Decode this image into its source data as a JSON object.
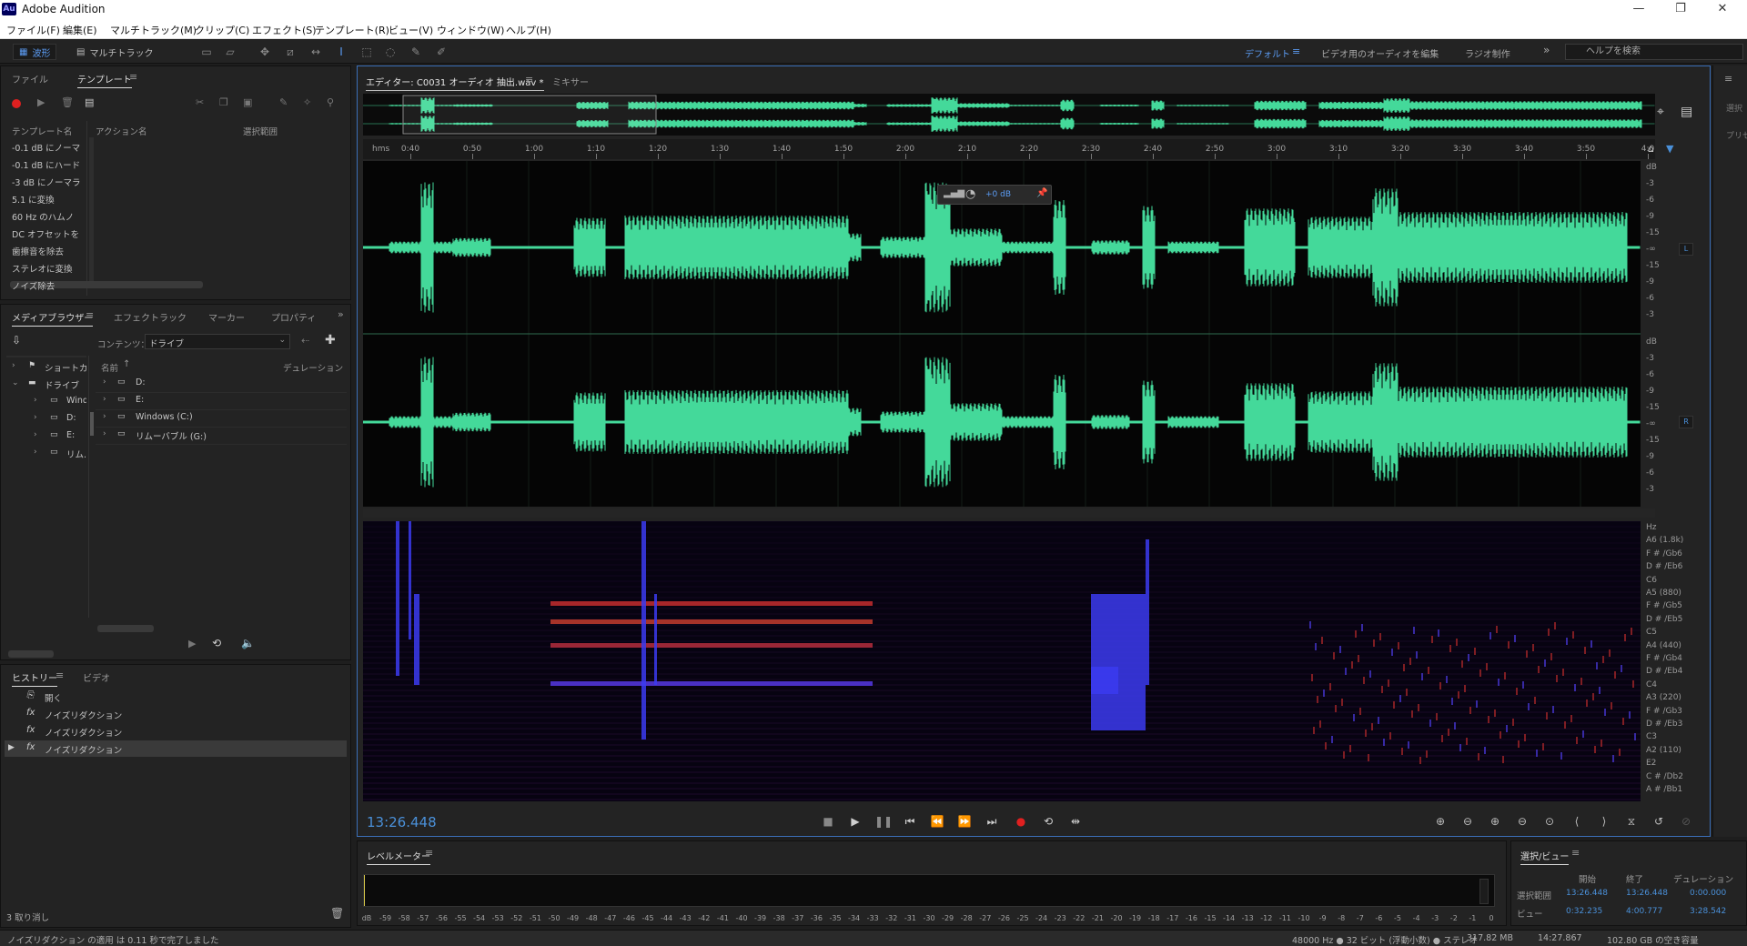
{
  "window": {
    "app_icon": "Au",
    "title": "Adobe Audition",
    "controls": {
      "minimize": "—",
      "maximize": "❐",
      "close": "✕"
    }
  },
  "menu": [
    "ファイル(F)",
    "編集(E)",
    "マルチトラック(M)",
    "クリップ(C)",
    "エフェクト(S)",
    "テンプレート(R)",
    "ビュー(V)",
    "ウィンドウ(W)",
    "ヘルプ(H)"
  ],
  "toolbar": {
    "waveform_label": "波形",
    "multitrack_label": "マルチトラック",
    "workspaces": [
      "デフォルト",
      "ビデオ用のオーディオを編集",
      "ラジオ制作"
    ],
    "active_workspace": "デフォルト",
    "more": "»",
    "search_placeholder": "ヘルプを検索"
  },
  "templates_panel": {
    "tabs": [
      "ファイル",
      "テンプレート"
    ],
    "active_tab": "テンプレート",
    "columns": [
      "テンプレート名",
      "アクション名",
      "選択範囲"
    ],
    "rows": [
      "-0.1 dB にノーマ",
      "-0.1 dB にハード",
      "-3 dB にノーマラ",
      "5.1 に変換",
      "60 Hz のハムノ",
      "DC オフセットを",
      "歯擦音を除去",
      "ステレオに変換",
      "ノイズ除去"
    ]
  },
  "media_panel": {
    "tabs": [
      "メディアブラウザー",
      "エフェクトラック",
      "マーカー",
      "プロパティ"
    ],
    "active_tab": "メディアブラウザー",
    "contents_label": "コンテンツ：",
    "contents_value": "ドライブ",
    "tree": [
      "ショートカ",
      "ドライブ",
      "Wind",
      "D:",
      "E:",
      "リム..."
    ],
    "columns": [
      "名前",
      "デュレーション"
    ],
    "items": [
      "D:",
      "E:",
      "Windows (C:)",
      "リムーバブル (G:)"
    ]
  },
  "history_panel": {
    "tabs": [
      "ヒストリー",
      "ビデオ"
    ],
    "active_tab": "ヒストリー",
    "items": [
      "開く",
      "ノイズリダクション",
      "ノイズリダクション",
      "ノイズリダクション"
    ],
    "selected_index": 3,
    "undo_count": "3 取り消し"
  },
  "editor": {
    "tabs": [
      "エディター: C0031 オーディオ 抽出.wav *",
      "ミキサー"
    ],
    "hud_gain": "+0 dB",
    "ruler_unit": "hms",
    "ruler_labels": [
      "0:40",
      "0:50",
      "1:00",
      "1:10",
      "1:20",
      "1:30",
      "1:40",
      "1:50",
      "2:00",
      "2:10",
      "2:20",
      "2:30",
      "2:40",
      "2:50",
      "3:00",
      "3:10",
      "3:20",
      "3:30",
      "3:40",
      "3:50",
      "4:0"
    ],
    "db_axis_top": [
      "dB",
      "-3",
      "-6",
      "-9",
      "-15",
      "-∞",
      "-15",
      "-9",
      "-6",
      "-3"
    ],
    "db_axis_bottom": [
      "dB",
      "-3",
      "-6",
      "-9",
      "-15",
      "-∞",
      "-15",
      "-9",
      "-6",
      "-3"
    ],
    "channel_left": "L",
    "channel_right": "R",
    "hz_axis": [
      "Hz",
      "A6 (1.8k)",
      "F # /Gb6",
      "D # /Eb6",
      "C6",
      "A5 (880)",
      "F # /Gb5",
      "D # /Eb5",
      "C5",
      "A4 (440)",
      "F # /Gb4",
      "D # /Eb4",
      "C4",
      "A3 (220)",
      "F # /Gb3",
      "D # /Eb3",
      "C3",
      "A2 (110)",
      "E2",
      "C # /Db2",
      "A # /Bb1"
    ],
    "timecode": "13:26.448",
    "colors": {
      "waveform": "#44d99a",
      "accent": "#4a90d9",
      "record": "#e02020"
    }
  },
  "level_meter": {
    "title": "レベルメーター",
    "scale": [
      "dB",
      "-59",
      "-58",
      "-57",
      "-56",
      "-55",
      "-54",
      "-53",
      "-52",
      "-51",
      "-50",
      "-49",
      "-48",
      "-47",
      "-46",
      "-45",
      "-44",
      "-43",
      "-42",
      "-41",
      "-40",
      "-39",
      "-38",
      "-37",
      "-36",
      "-35",
      "-34",
      "-33",
      "-32",
      "-31",
      "-30",
      "-29",
      "-28",
      "-27",
      "-26",
      "-25",
      "-24",
      "-23",
      "-22",
      "-21",
      "-20",
      "-19",
      "-18",
      "-17",
      "-16",
      "-15",
      "-14",
      "-13",
      "-12",
      "-11",
      "-10",
      "-9",
      "-8",
      "-7",
      "-6",
      "-5",
      "-4",
      "-3",
      "-2",
      "-1",
      "0"
    ]
  },
  "selection_view": {
    "title": "選択/ビュー",
    "columns": [
      "開始",
      "終了",
      "デュレーション"
    ],
    "selection_label": "選択範囲",
    "selection": [
      "13:26.448",
      "13:26.448",
      "0:00.000"
    ],
    "view_label": "ビュー",
    "view": [
      "0:32.235",
      "4:00.777",
      "3:28.542"
    ]
  },
  "status": {
    "message": "ノイズリダクション の適用 は 0.11 秒で完了しました",
    "format": "48000 Hz ● 32 ビット (浮動小数) ● ステレオ",
    "file_size": "317.82 MB",
    "duration": "14:27.867",
    "disk_free": "102.80 GB の空き容量"
  },
  "right_strip": [
    "選択",
    "プリセ"
  ]
}
